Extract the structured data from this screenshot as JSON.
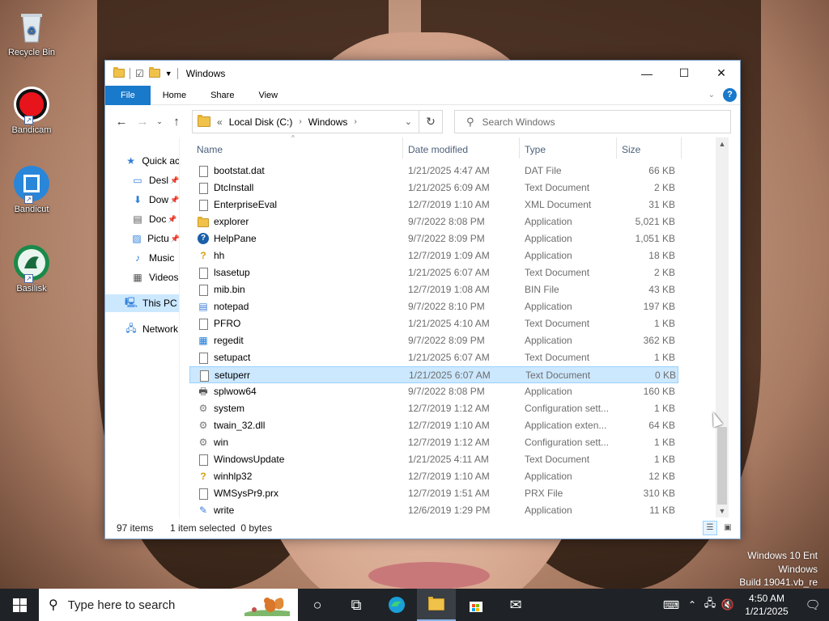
{
  "desktop": {
    "icons": [
      {
        "label": "Recycle Bin"
      },
      {
        "label": "Bandicam"
      },
      {
        "label": "Bandicut"
      },
      {
        "label": "Basilisk"
      }
    ],
    "watermark": [
      "Windows 10 Ent",
      "Windows",
      "Build 19041.vb_re"
    ]
  },
  "window": {
    "title": "Windows",
    "ribbon_tabs": [
      "File",
      "Home",
      "Share",
      "View"
    ],
    "help_label": "?",
    "address": {
      "prefix": "«",
      "segments": [
        "Local Disk (C:)",
        "Windows"
      ]
    },
    "search_placeholder": "Search Windows",
    "nav_pane": [
      {
        "label": "Quick ac",
        "icon": "star-icon",
        "pinned": false
      },
      {
        "label": "Desl",
        "icon": "desktop-icon",
        "pinned": true
      },
      {
        "label": "Dow",
        "icon": "download-icon",
        "pinned": true
      },
      {
        "label": "Doc",
        "icon": "documents-icon",
        "pinned": true
      },
      {
        "label": "Pictu",
        "icon": "pictures-icon",
        "pinned": true
      },
      {
        "label": "Music",
        "icon": "music-icon",
        "pinned": false
      },
      {
        "label": "Videos",
        "icon": "videos-icon",
        "pinned": false
      },
      {
        "label": "This PC",
        "icon": "computer-icon",
        "pinned": false,
        "selected": true
      },
      {
        "label": "Network",
        "icon": "network-icon",
        "pinned": false
      }
    ],
    "columns": [
      "Name",
      "Date modified",
      "Type",
      "Size"
    ],
    "files": [
      {
        "name": "bootstat.dat",
        "date": "1/21/2025 4:47 AM",
        "type": "DAT File",
        "size": "66 KB",
        "icon": "file-icon"
      },
      {
        "name": "DtcInstall",
        "date": "1/21/2025 6:09 AM",
        "type": "Text Document",
        "size": "2 KB",
        "icon": "text-file-icon"
      },
      {
        "name": "EnterpriseEval",
        "date": "12/7/2019 1:10 AM",
        "type": "XML Document",
        "size": "31 KB",
        "icon": "xml-file-icon"
      },
      {
        "name": "explorer",
        "date": "9/7/2022 8:08 PM",
        "type": "Application",
        "size": "5,021 KB",
        "icon": "folder-app-icon"
      },
      {
        "name": "HelpPane",
        "date": "9/7/2022 8:09 PM",
        "type": "Application",
        "size": "1,051 KB",
        "icon": "help-icon"
      },
      {
        "name": "hh",
        "date": "12/7/2019 1:09 AM",
        "type": "Application",
        "size": "18 KB",
        "icon": "help-file-icon"
      },
      {
        "name": "lsasetup",
        "date": "1/21/2025 6:07 AM",
        "type": "Text Document",
        "size": "2 KB",
        "icon": "text-file-icon"
      },
      {
        "name": "mib.bin",
        "date": "12/7/2019 1:08 AM",
        "type": "BIN File",
        "size": "43 KB",
        "icon": "file-icon"
      },
      {
        "name": "notepad",
        "date": "9/7/2022 8:10 PM",
        "type": "Application",
        "size": "197 KB",
        "icon": "notepad-icon"
      },
      {
        "name": "PFRO",
        "date": "1/21/2025 4:10 AM",
        "type": "Text Document",
        "size": "1 KB",
        "icon": "text-file-icon"
      },
      {
        "name": "regedit",
        "date": "9/7/2022 8:09 PM",
        "type": "Application",
        "size": "362 KB",
        "icon": "regedit-icon"
      },
      {
        "name": "setupact",
        "date": "1/21/2025 6:07 AM",
        "type": "Text Document",
        "size": "1 KB",
        "icon": "text-file-icon"
      },
      {
        "name": "setuperr",
        "date": "1/21/2025 6:07 AM",
        "type": "Text Document",
        "size": "0 KB",
        "icon": "text-file-icon",
        "selected": true
      },
      {
        "name": "splwow64",
        "date": "9/7/2022 8:08 PM",
        "type": "Application",
        "size": "160 KB",
        "icon": "printer-icon"
      },
      {
        "name": "system",
        "date": "12/7/2019 1:12 AM",
        "type": "Configuration sett...",
        "size": "1 KB",
        "icon": "config-file-icon"
      },
      {
        "name": "twain_32.dll",
        "date": "12/7/2019 1:10 AM",
        "type": "Application exten...",
        "size": "64 KB",
        "icon": "dll-file-icon"
      },
      {
        "name": "win",
        "date": "12/7/2019 1:12 AM",
        "type": "Configuration sett...",
        "size": "1 KB",
        "icon": "config-file-icon"
      },
      {
        "name": "WindowsUpdate",
        "date": "1/21/2025 4:11 AM",
        "type": "Text Document",
        "size": "1 KB",
        "icon": "text-file-icon"
      },
      {
        "name": "winhlp32",
        "date": "12/7/2019 1:10 AM",
        "type": "Application",
        "size": "12 KB",
        "icon": "help-file-icon"
      },
      {
        "name": "WMSysPr9.prx",
        "date": "12/7/2019 1:51 AM",
        "type": "PRX File",
        "size": "310 KB",
        "icon": "file-icon"
      },
      {
        "name": "write",
        "date": "12/6/2019 1:29 PM",
        "type": "Application",
        "size": "11 KB",
        "icon": "wordpad-icon"
      }
    ],
    "status": {
      "items": "97 items",
      "selection": "1 item selected  0 bytes"
    }
  },
  "taskbar": {
    "search_placeholder": "Type here to search",
    "clock_time": "4:50 AM",
    "clock_date": "1/21/2025"
  },
  "colors": {
    "accent": "#1979ca",
    "selection": "#cce8ff",
    "taskbar": "#1f2327"
  }
}
